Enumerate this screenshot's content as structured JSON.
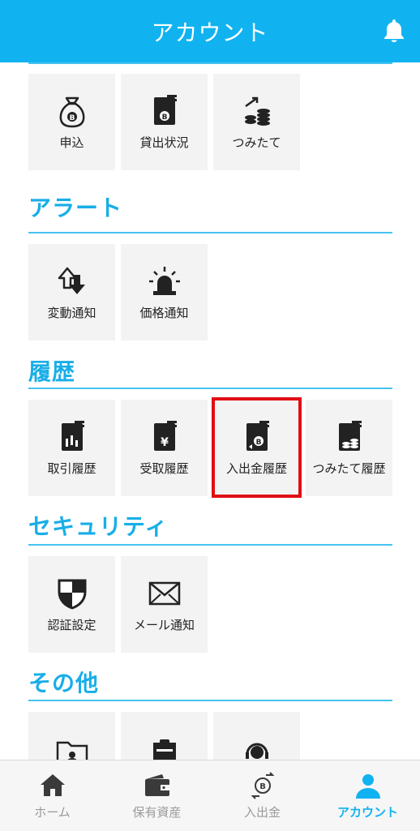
{
  "header": {
    "title": "アカウント"
  },
  "sections": {
    "loan": {
      "items": [
        {
          "label": "申込"
        },
        {
          "label": "貸出状況"
        },
        {
          "label": "つみたて"
        }
      ]
    },
    "alert": {
      "title": "アラート",
      "items": [
        {
          "label": "変動通知"
        },
        {
          "label": "価格通知"
        }
      ]
    },
    "history": {
      "title": "履歴",
      "items": [
        {
          "label": "取引履歴"
        },
        {
          "label": "受取履歴"
        },
        {
          "label": "入出金履歴"
        },
        {
          "label": "つみたて履歴"
        }
      ]
    },
    "security": {
      "title": "セキュリティ",
      "items": [
        {
          "label": "認証設定"
        },
        {
          "label": "メール通知"
        }
      ]
    },
    "other": {
      "title": "その他"
    }
  },
  "tabbar": {
    "items": [
      {
        "label": "ホーム"
      },
      {
        "label": "保有資産"
      },
      {
        "label": "入出金"
      },
      {
        "label": "アカウント"
      }
    ],
    "active_index": 3
  },
  "colors": {
    "accent": "#10b3f0",
    "highlight": "#e10e15",
    "tile_bg": "#f3f3f3"
  }
}
